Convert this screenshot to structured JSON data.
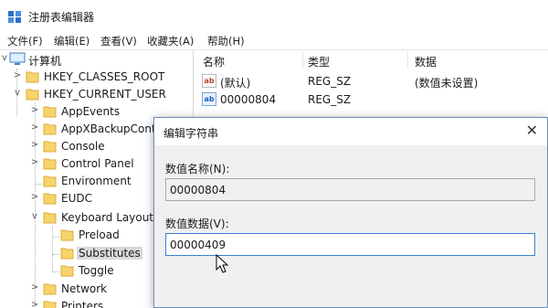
{
  "window": {
    "title": "注册表编辑器",
    "icon": "regedit-icon"
  },
  "menu": [
    "文件(F)",
    "编辑(E)",
    "查看(V)",
    "收藏夹(A)",
    "帮助(H)"
  ],
  "tree": {
    "root": "计算机",
    "nodes": [
      {
        "label": "HKEY_CLASSES_ROOT",
        "chevron": ">"
      },
      {
        "label": "HKEY_CURRENT_USER",
        "chevron": "v"
      },
      {
        "label": "AppEvents",
        "chevron": ">"
      },
      {
        "label": "AppXBackupConte",
        "chevron": ">"
      },
      {
        "label": "Console",
        "chevron": ">"
      },
      {
        "label": "Control Panel",
        "chevron": ">"
      },
      {
        "label": "Environment",
        "chevron": ""
      },
      {
        "label": "EUDC",
        "chevron": ">"
      },
      {
        "label": "Keyboard Layout",
        "chevron": "v"
      },
      {
        "label": "Preload",
        "chevron": ""
      },
      {
        "label": "Substitutes",
        "chevron": "",
        "selected": true
      },
      {
        "label": "Toggle",
        "chevron": ""
      },
      {
        "label": "Network",
        "chevron": ">"
      },
      {
        "label": "Printers",
        "chevron": ">"
      }
    ]
  },
  "list": {
    "columns": [
      "名称",
      "类型",
      "数据"
    ],
    "rows": [
      {
        "icon": "ab",
        "name": "(默认)",
        "type": "REG_SZ",
        "data": "(数值未设置)"
      },
      {
        "icon": "ab",
        "name": "00000804",
        "type": "REG_SZ",
        "data": ""
      }
    ]
  },
  "dialog": {
    "title": "编辑字符串",
    "close_glyph": "✕",
    "name_label": "数值名称(N):",
    "name_value": "00000804",
    "data_label": "数值数据(V):",
    "data_value": "00000409"
  },
  "colors": {
    "folder": "#f6d36b",
    "accent": "#3c7fd6",
    "dialog_border": "#6b8fb5"
  }
}
